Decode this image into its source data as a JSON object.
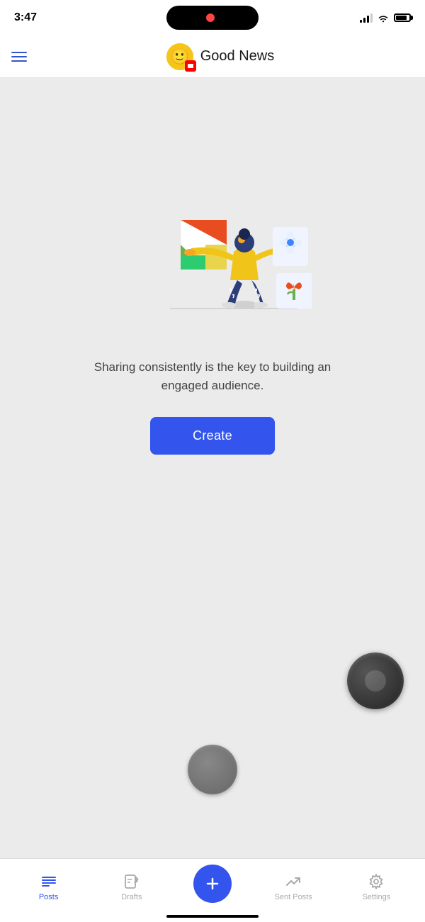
{
  "statusBar": {
    "time": "3:47",
    "island": true
  },
  "header": {
    "title": "Good News",
    "menuLabel": "Menu",
    "avatarEmoji": "😊"
  },
  "main": {
    "tagline": "Sharing consistently is the key to building an engaged audience.",
    "createButton": "Create"
  },
  "bottomNav": {
    "items": [
      {
        "id": "posts",
        "label": "Posts",
        "active": true
      },
      {
        "id": "drafts",
        "label": "Drafts",
        "active": false
      },
      {
        "id": "create",
        "label": "",
        "isCenter": true
      },
      {
        "id": "sent-posts",
        "label": "Sent Posts",
        "active": false
      },
      {
        "id": "settings",
        "label": "Settings",
        "active": false
      }
    ]
  }
}
